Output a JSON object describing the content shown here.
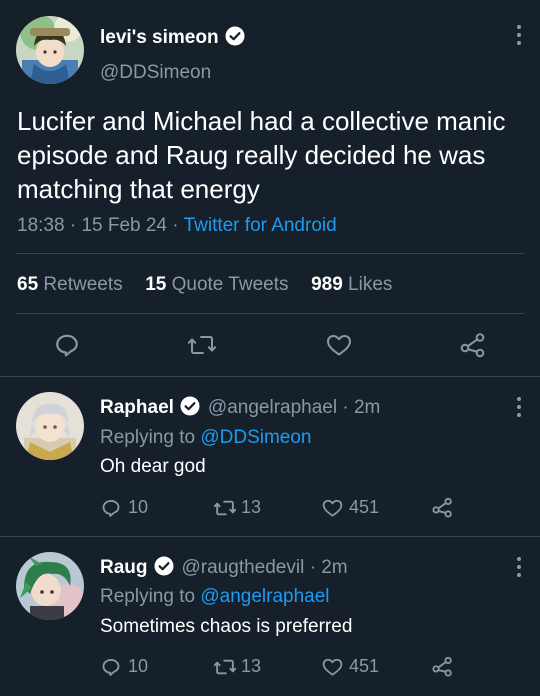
{
  "main_tweet": {
    "display_name": "levi's simeon",
    "handle": "@DDSimeon",
    "text": "Lucifer and Michael had a collective manic episode and Raug really decided he was matching that energy",
    "time": "18:38",
    "date": "15 Feb 24",
    "source": "Twitter for Android",
    "stats": {
      "retweets_count": "65",
      "retweets_label": "Retweets",
      "quotes_count": "15",
      "quotes_label": "Quote Tweets",
      "likes_count": "989",
      "likes_label": "Likes"
    }
  },
  "replies": [
    {
      "display_name": "Raphael",
      "handle": "@angelraphael",
      "age": "2m",
      "replying_label": "Replying to",
      "replying_to": "@DDSimeon",
      "text": "Oh dear god",
      "reply_count": "10",
      "retweet_count": "13",
      "like_count": "451"
    },
    {
      "display_name": "Raug",
      "handle": "@raugthedevil",
      "age": "2m",
      "replying_label": "Replying to",
      "replying_to": "@angelraphael",
      "text": "Sometimes chaos is preferred",
      "reply_count": "10",
      "retweet_count": "13",
      "like_count": "451"
    }
  ],
  "colors": {
    "background": "#15202b",
    "link": "#1d9bf0",
    "muted": "#8899a6",
    "divider": "#38444d"
  },
  "icons": [
    "verified-badge-icon",
    "more-options-icon",
    "reply-icon",
    "retweet-icon",
    "like-icon",
    "share-icon"
  ]
}
